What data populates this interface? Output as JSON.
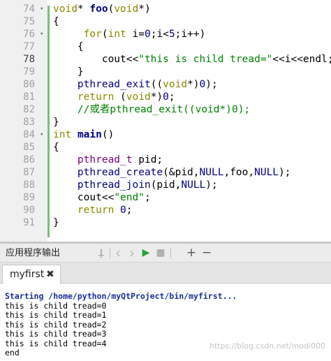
{
  "editor": {
    "current_line": "78",
    "lines": [
      {
        "num": "74",
        "fold": "▾",
        "parts": [
          [
            "kw",
            "void"
          ],
          [
            "",
            "* "
          ],
          [
            "fn bold",
            "foo"
          ],
          [
            "",
            "("
          ],
          [
            "kw",
            "void"
          ],
          [
            "",
            "*)"
          ]
        ]
      },
      {
        "num": "75",
        "fold": "",
        "parts": [
          [
            "",
            "{"
          ]
        ]
      },
      {
        "num": "76",
        "fold": "▾",
        "parts": [
          [
            "",
            "     "
          ],
          [
            "kw",
            "for"
          ],
          [
            "",
            "("
          ],
          [
            "kw",
            "int"
          ],
          [
            "",
            " i="
          ],
          [
            "num",
            "0"
          ],
          [
            "",
            ";i<"
          ],
          [
            "num",
            "5"
          ],
          [
            "",
            ";i++)"
          ]
        ]
      },
      {
        "num": "77",
        "fold": "",
        "parts": [
          [
            "",
            "    {"
          ]
        ]
      },
      {
        "num": "78",
        "fold": "",
        "parts": [
          [
            "",
            "        cout<<"
          ],
          [
            "str",
            "\"this is child tread=\""
          ],
          [
            "",
            "<<i<<endl;"
          ]
        ]
      },
      {
        "num": "79",
        "fold": "",
        "parts": [
          [
            "",
            "    }"
          ]
        ]
      },
      {
        "num": "80",
        "fold": "",
        "parts": [
          [
            "",
            "    "
          ],
          [
            "fn",
            "pthread_exit"
          ],
          [
            "",
            "(("
          ],
          [
            "kw",
            "void"
          ],
          [
            "",
            "*)"
          ],
          [
            "num",
            "0"
          ],
          [
            "",
            ");"
          ]
        ]
      },
      {
        "num": "81",
        "fold": "",
        "parts": [
          [
            "",
            "    "
          ],
          [
            "kw",
            "return"
          ],
          [
            "",
            "",
            " "
          ],
          [
            "",
            "("
          ],
          [
            "kw",
            "void"
          ],
          [
            "",
            "*)"
          ],
          [
            "num",
            "0"
          ],
          [
            "",
            ";"
          ]
        ]
      },
      {
        "num": "82",
        "fold": "",
        "parts": [
          [
            "",
            "    "
          ],
          [
            "cm",
            "//或者pthread_exit((void*)0);"
          ]
        ]
      },
      {
        "num": "83",
        "fold": "",
        "parts": [
          [
            "",
            "}"
          ]
        ]
      },
      {
        "num": "84",
        "fold": "▾",
        "parts": [
          [
            "kw",
            "int"
          ],
          [
            "",
            "",
            " "
          ],
          [
            "fn bold",
            "main"
          ],
          [
            "",
            "()"
          ]
        ]
      },
      {
        "num": "85",
        "fold": "",
        "parts": [
          [
            "",
            "{"
          ]
        ]
      },
      {
        "num": "86",
        "fold": "",
        "parts": [
          [
            "",
            "    "
          ],
          [
            "ty",
            "pthread_t"
          ],
          [
            "",
            "",
            " "
          ],
          [
            "",
            "pid;"
          ]
        ]
      },
      {
        "num": "87",
        "fold": "",
        "parts": [
          [
            "",
            "    "
          ],
          [
            "fn",
            "pthread_create"
          ],
          [
            "",
            "(&pid,"
          ],
          [
            "num",
            "NULL"
          ],
          [
            "",
            ",foo,"
          ],
          [
            "num",
            "NULL"
          ],
          [
            "",
            ");"
          ]
        ]
      },
      {
        "num": "88",
        "fold": "",
        "parts": [
          [
            "",
            "    "
          ],
          [
            "fn",
            "pthread_join"
          ],
          [
            "",
            "(pid,"
          ],
          [
            "num",
            "NULL"
          ],
          [
            "",
            ");"
          ]
        ]
      },
      {
        "num": "89",
        "fold": "",
        "parts": [
          [
            "",
            "    cout<<"
          ],
          [
            "str",
            "\"end\""
          ],
          [
            "",
            ";"
          ]
        ]
      },
      {
        "num": "90",
        "fold": "",
        "parts": [
          [
            "",
            "    "
          ],
          [
            "kw",
            "return"
          ],
          [
            "",
            "",
            " "
          ],
          [
            "num",
            "0"
          ],
          [
            "",
            ";"
          ]
        ]
      },
      {
        "num": "91",
        "fold": "",
        "parts": [
          [
            "",
            "}"
          ]
        ]
      }
    ]
  },
  "output_pane": {
    "title": "应用程序输出",
    "icons": {
      "attach": "attach-icon",
      "prev": "chevron-left-icon",
      "next": "chevron-right-icon",
      "run": "play-icon",
      "stop": "stop-icon",
      "add": "plus-icon",
      "remove": "minus-icon"
    },
    "attach_glyph": "⍊",
    "prev_glyph": "‹",
    "next_glyph": "›",
    "run_glyph": "▶",
    "stop_glyph": "■",
    "add_glyph": "+",
    "remove_glyph": "−"
  },
  "tab": {
    "label": "myfirst",
    "close": "✖"
  },
  "console": {
    "start_line": "Starting /home/python/myQtProject/bin/myfirst...",
    "lines": [
      "this is child tread=0",
      "this is child tread=1",
      "this is child tread=2",
      "this is child tread=3",
      "this is child tread=4",
      "end"
    ],
    "watermark": "https://blog.csdn.net/modi000"
  },
  "colors": {
    "keyword": "#8a8a00",
    "function": "#000080",
    "string": "#008000",
    "number": "#000080",
    "type": "#800080",
    "comment": "#008000",
    "start_line": "#1b2f9a",
    "change_bar": "#78c078",
    "run_button": "#2e9b3a"
  }
}
